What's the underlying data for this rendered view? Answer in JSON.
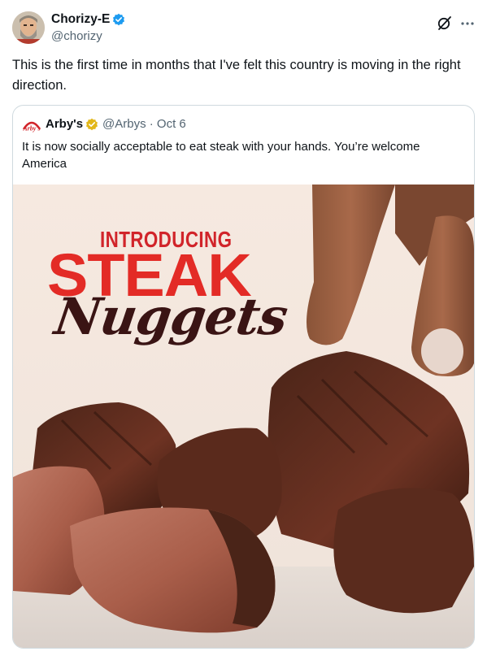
{
  "author": {
    "name": "Chorizy-E",
    "handle": "@chorizy",
    "verified": true,
    "avatar_icon": "avatar-icon"
  },
  "header_icons": [
    "grok-icon",
    "more-icon"
  ],
  "more_glyph": "···",
  "tweet_text": "This is the first time in months that I've felt this country is moving in the right direction.",
  "quoted": {
    "name": "Arby's",
    "handle": "@Arbys",
    "separator": "·",
    "date": "Oct 6",
    "verified_color": "#e2b719",
    "text": "It is now socially acceptable to eat steak with your hands. You’re welcome America",
    "media": {
      "line1": "INTRODUCING",
      "line2": "STEAK",
      "line3": "Nuggets",
      "brand_color": "#d1242a"
    }
  },
  "colors": {
    "verified_blue": "#1d9bf0",
    "text": "#0f1419",
    "muted": "#536471",
    "border": "#cfd9de"
  }
}
